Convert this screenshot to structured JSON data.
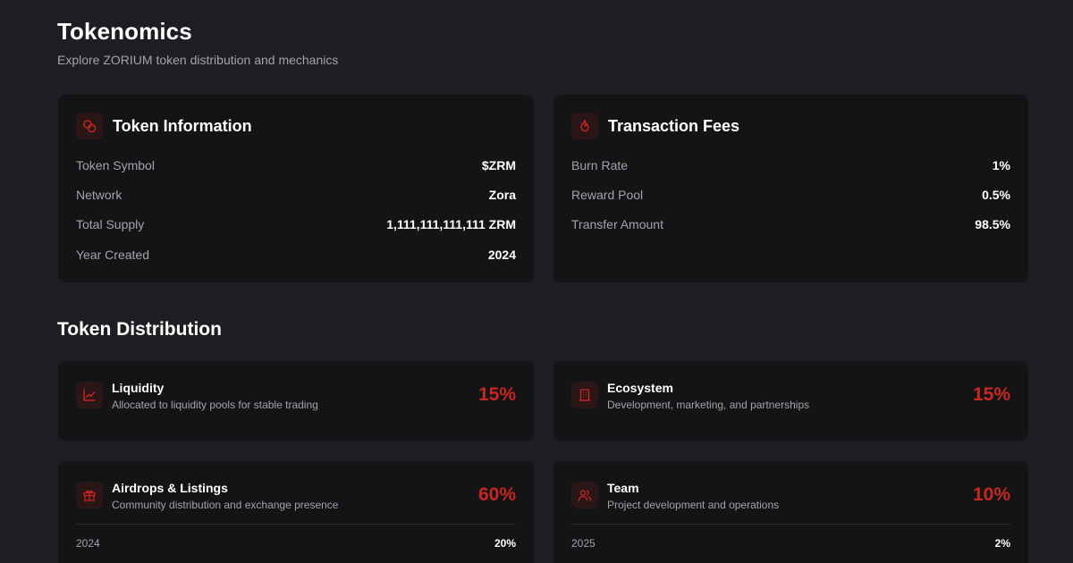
{
  "header": {
    "title": "Tokenomics",
    "subtitle": "Explore ZORIUM token distribution and mechanics"
  },
  "token_info": {
    "title": "Token Information",
    "icon": "coins-icon",
    "rows": [
      {
        "label": "Token Symbol",
        "value": "$ZRM"
      },
      {
        "label": "Network",
        "value": "Zora"
      },
      {
        "label": "Total Supply",
        "value": "1,111,111,111,111 ZRM"
      },
      {
        "label": "Year Created",
        "value": "2024"
      }
    ]
  },
  "fees": {
    "title": "Transaction Fees",
    "icon": "flame-icon",
    "rows": [
      {
        "label": "Burn Rate",
        "value": "1%"
      },
      {
        "label": "Reward Pool",
        "value": "0.5%"
      },
      {
        "label": "Transfer Amount",
        "value": "98.5%"
      }
    ]
  },
  "distribution": {
    "title": "Token Distribution",
    "accent_color": "#c8271f",
    "items": [
      {
        "name": "Liquidity",
        "description": "Allocated to liquidity pools for stable trading",
        "percent": "15%",
        "icon": "chart-line-icon"
      },
      {
        "name": "Ecosystem",
        "description": "Development, marketing, and partnerships",
        "percent": "15%",
        "icon": "building-icon"
      },
      {
        "name": "Airdrops & Listings",
        "description": "Community distribution and exchange presence",
        "percent": "60%",
        "icon": "gift-icon",
        "schedule": [
          {
            "year": "2024",
            "value": "20%"
          }
        ]
      },
      {
        "name": "Team",
        "description": "Project development and operations",
        "percent": "10%",
        "icon": "users-icon",
        "schedule": [
          {
            "year": "2025",
            "value": "2%"
          }
        ]
      }
    ]
  }
}
